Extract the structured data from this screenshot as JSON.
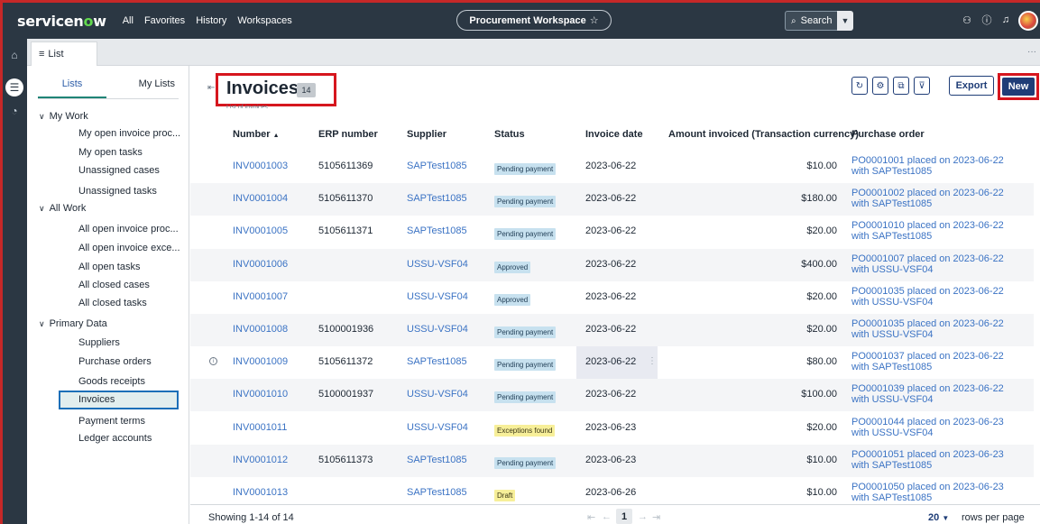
{
  "topnav": {
    "logo_text": "servicenow",
    "links": [
      "All",
      "Favorites",
      "History",
      "Workspaces"
    ],
    "workspace_title": "Procurement Workspace",
    "search_placeholder": "Search"
  },
  "tabs": {
    "list_tab": "List"
  },
  "sidebar": {
    "tab_lists": "Lists",
    "tab_my_lists": "My Lists",
    "groups": [
      {
        "label": "My Work",
        "items": [
          "My open invoice proc...",
          "My open tasks",
          "Unassigned cases",
          "Unassigned tasks"
        ]
      },
      {
        "label": "All Work",
        "items": [
          "All open invoice proc...",
          "All open invoice exce...",
          "All open tasks",
          "All closed cases",
          "All closed tasks"
        ]
      },
      {
        "label": "Primary Data",
        "items": [
          "Suppliers",
          "Purchase orders",
          "Goods receipts",
          "Invoices",
          "Payment terms",
          "Ledger accounts"
        ]
      }
    ]
  },
  "main": {
    "title": "Invoices",
    "count": "14",
    "subtitle": "List of invoices",
    "export_label": "Export",
    "new_label": "New",
    "columns": [
      "Number",
      "ERP number",
      "Supplier",
      "Status",
      "Invoice date",
      "Amount invoiced (Transaction currency)",
      "Purchase order"
    ],
    "sort_indicator": "▲",
    "rows": [
      {
        "number": "INV0001003",
        "erp": "5105611369",
        "supplier": "SAPTest1085",
        "status": "Pending payment",
        "date": "2023-06-22",
        "amount": "$10.00",
        "po": "PO0001001 placed on 2023-06-22 with SAPTest1085"
      },
      {
        "number": "INV0001004",
        "erp": "5105611370",
        "supplier": "SAPTest1085",
        "status": "Pending payment",
        "date": "2023-06-22",
        "amount": "$180.00",
        "po": "PO0001002 placed on 2023-06-22 with SAPTest1085"
      },
      {
        "number": "INV0001005",
        "erp": "5105611371",
        "supplier": "SAPTest1085",
        "status": "Pending payment",
        "date": "2023-06-22",
        "amount": "$20.00",
        "po": "PO0001010 placed on 2023-06-22 with SAPTest1085"
      },
      {
        "number": "INV0001006",
        "erp": "",
        "supplier": "USSU-VSF04",
        "status": "Approved",
        "date": "2023-06-22",
        "amount": "$400.00",
        "po": "PO0001007 placed on 2023-06-22 with USSU-VSF04"
      },
      {
        "number": "INV0001007",
        "erp": "",
        "supplier": "USSU-VSF04",
        "status": "Approved",
        "date": "2023-06-22",
        "amount": "$20.00",
        "po": "PO0001035 placed on 2023-06-22 with USSU-VSF04"
      },
      {
        "number": "INV0001008",
        "erp": "5100001936",
        "supplier": "USSU-VSF04",
        "status": "Pending payment",
        "date": "2023-06-22",
        "amount": "$20.00",
        "po": "PO0001035 placed on 2023-06-22 with USSU-VSF04"
      },
      {
        "number": "INV0001009",
        "erp": "5105611372",
        "supplier": "SAPTest1085",
        "status": "Pending payment",
        "date": "2023-06-22",
        "amount": "$80.00",
        "po": "PO0001037 placed on 2023-06-22 with SAPTest1085"
      },
      {
        "number": "INV0001010",
        "erp": "5100001937",
        "supplier": "USSU-VSF04",
        "status": "Pending payment",
        "date": "2023-06-22",
        "amount": "$100.00",
        "po": "PO0001039 placed on 2023-06-22 with USSU-VSF04"
      },
      {
        "number": "INV0001011",
        "erp": "",
        "supplier": "USSU-VSF04",
        "status": "Exceptions found",
        "date": "2023-06-23",
        "amount": "$20.00",
        "po": "PO0001044 placed on 2023-06-23 with USSU-VSF04"
      },
      {
        "number": "INV0001012",
        "erp": "5105611373",
        "supplier": "SAPTest1085",
        "status": "Pending payment",
        "date": "2023-06-23",
        "amount": "$10.00",
        "po": "PO0001051 placed on 2023-06-23 with SAPTest1085"
      },
      {
        "number": "INV0001013",
        "erp": "",
        "supplier": "SAPTest1085",
        "status": "Draft",
        "date": "2023-06-26",
        "amount": "$10.00",
        "po": "PO0001050 placed on 2023-06-23 with SAPTest1085"
      }
    ]
  },
  "footer": {
    "showing": "Showing 1-14 of 14",
    "current_page": "1",
    "rows_per_page_value": "20",
    "rows_per_page_label": "rows per page"
  },
  "colors": {
    "nav_bg": "#2b3743",
    "accent": "#1f3d77",
    "link": "#3b73c4",
    "highlight_red": "#d6161e",
    "logo_green": "#62d84e"
  }
}
